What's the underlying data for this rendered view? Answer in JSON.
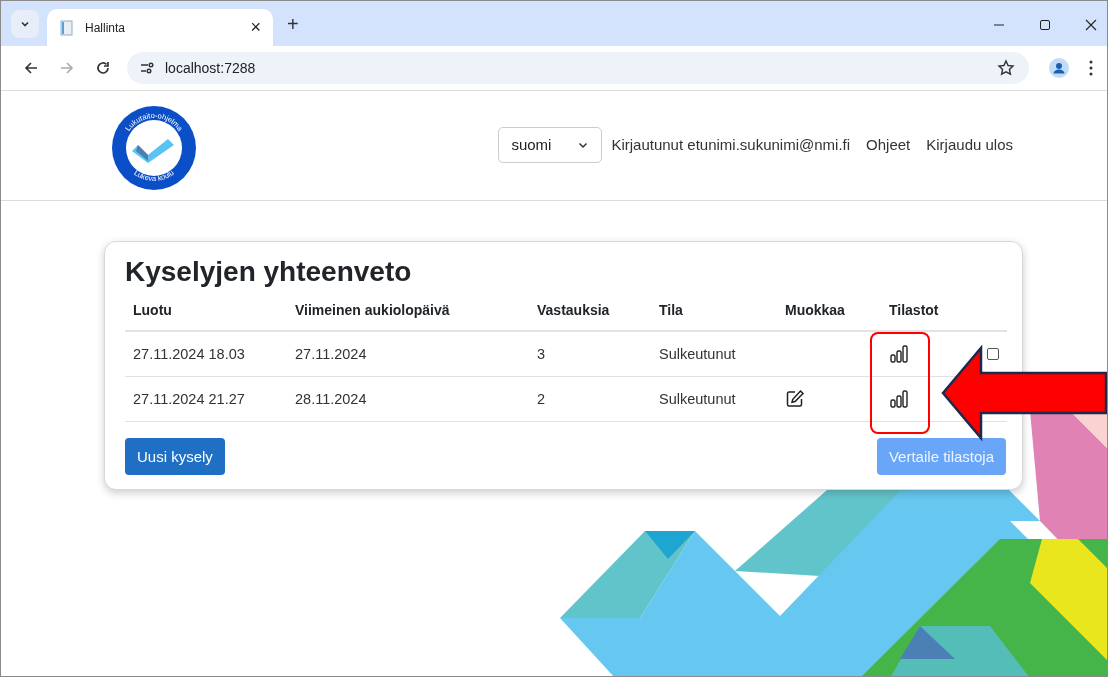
{
  "browser": {
    "tabs": [
      {
        "title": "Hallinta",
        "selected": true
      }
    ],
    "close_tab": "×",
    "new_tab": "+",
    "address": "localhost:7288"
  },
  "header": {
    "logo": {
      "top_text": "Lukutaito-ohjelma",
      "bottom_text": "Lukeva koulu"
    },
    "language": {
      "value": "suomi"
    },
    "user": "Kirjautunut etunimi.sukunimi@nmi.fi",
    "links": [
      "Ohjeet",
      "Kirjaudu ulos"
    ]
  },
  "summary": {
    "title": "Kyselyjen yhteenveto",
    "columns": [
      "Luotu",
      "Viimeinen aukiolopäivä",
      "Vastauksia",
      "Tila",
      "Muokkaa",
      "Tilastot"
    ],
    "rows": [
      {
        "created": "27.11.2024 18.03",
        "last_open_day": "27.11.2024",
        "responses": "3",
        "status": "Sulkeutunut",
        "editable": false,
        "compare": {
          "checked": false
        }
      },
      {
        "created": "27.11.2024 21.27",
        "last_open_day": "28.11.2024",
        "responses": "2",
        "status": "Sulkeutunut",
        "editable": true
      }
    ],
    "new_button": "Uusi kysely",
    "compare_button": {
      "label": "Vertaile tilastoja",
      "disabled": true
    }
  }
}
